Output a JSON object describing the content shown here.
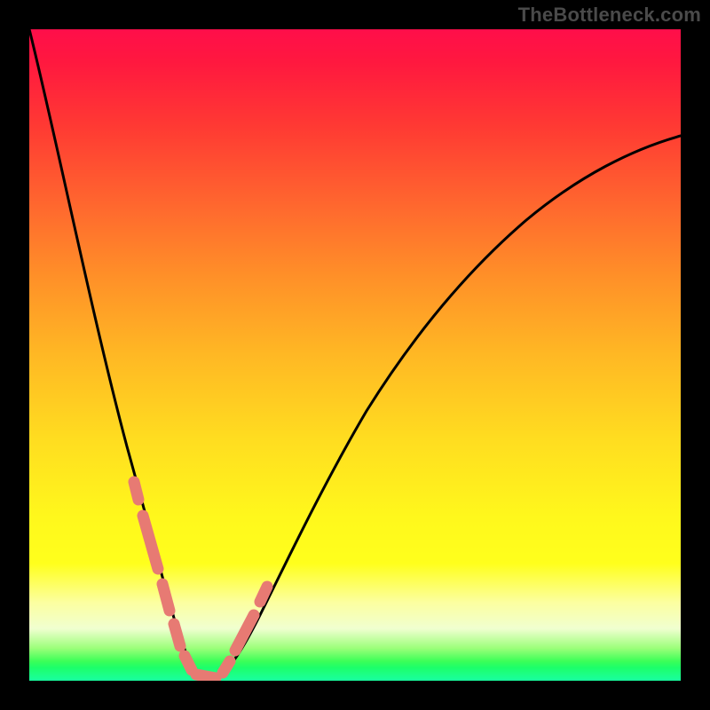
{
  "watermark": "TheBottleneck.com",
  "colors": {
    "background": "#000000",
    "gradient_top": "#ff0e4a",
    "gradient_bottom": "#18ffa0",
    "curve": "#000000",
    "marker": "#e77a73"
  },
  "chart_data": {
    "type": "line",
    "title": "",
    "xlabel": "",
    "ylabel": "",
    "xlim": [
      0,
      100
    ],
    "ylim": [
      0,
      100
    ],
    "x": [
      0,
      2,
      4,
      6,
      8,
      10,
      12,
      14,
      16,
      17,
      18,
      19,
      20,
      21,
      22,
      23,
      24,
      25,
      27,
      30,
      34,
      38,
      43,
      48,
      54,
      60,
      67,
      74,
      82,
      90,
      100
    ],
    "y": [
      100,
      90,
      80,
      70,
      60,
      51,
      42,
      34,
      26,
      22,
      18,
      14,
      11,
      8,
      5,
      3,
      1.5,
      0.5,
      0,
      1,
      5,
      12,
      22,
      33,
      44,
      53,
      61,
      68,
      74,
      79,
      84
    ],
    "markers": {
      "note": "Highlighted segments near the curve minimum (pink capsule markers)",
      "x": [
        15.5,
        16.5,
        17.5,
        18.5,
        19.8,
        20.5,
        21.2,
        22.5,
        23.5,
        25,
        27.2,
        28.5,
        29.5,
        30.5,
        31.5
      ],
      "y": [
        29,
        24,
        20,
        15,
        11,
        7,
        5,
        2.5,
        1,
        0.4,
        0.8,
        2.5,
        4.5,
        6.5,
        9
      ]
    }
  }
}
